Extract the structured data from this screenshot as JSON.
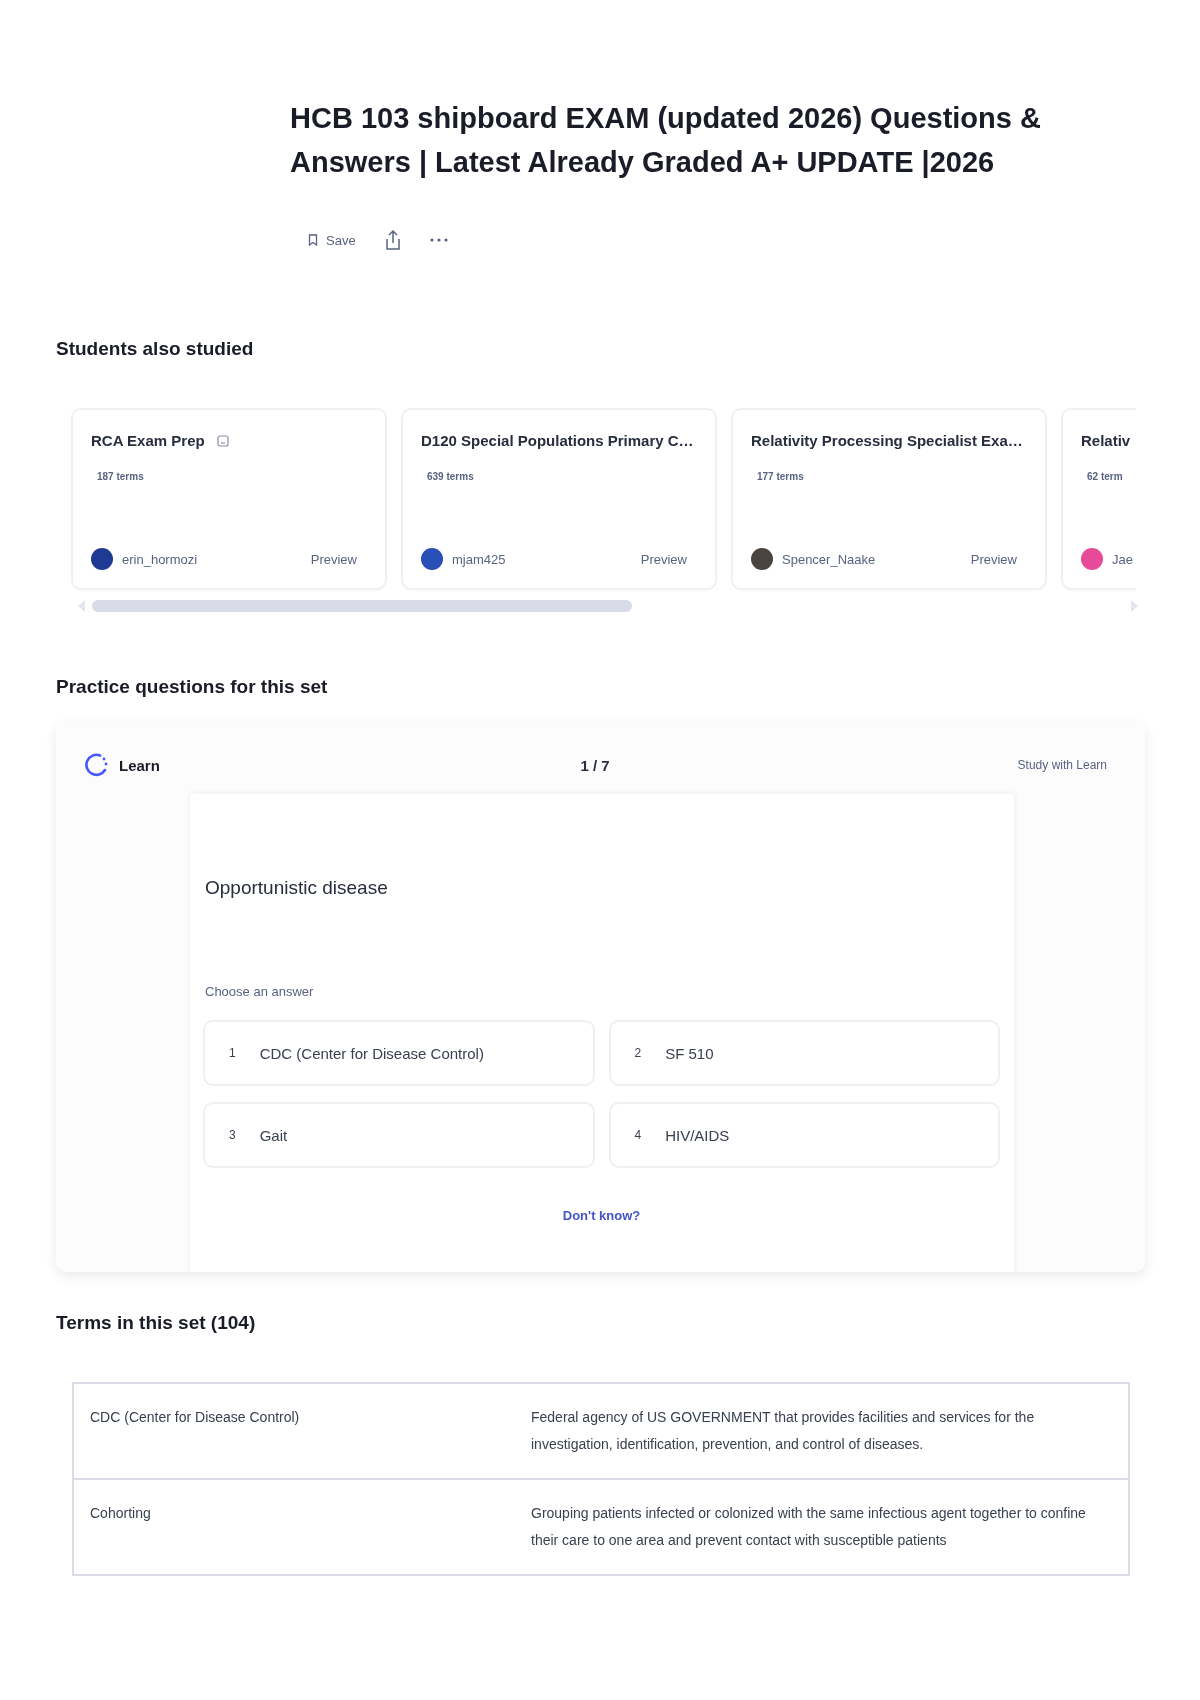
{
  "title": "HCB 103 shipboard EXAM (updated 2026) Questions & Answers | Latest Already Graded A+ UPDATE |2026",
  "actions": {
    "save": "Save"
  },
  "students_also_studied": {
    "heading": "Students also studied",
    "cards": [
      {
        "title": "RCA Exam Prep",
        "has_icon": true,
        "terms": "187 terms",
        "user": "erin_hormozi",
        "color": "#1f3a93",
        "preview": "Preview"
      },
      {
        "title": "D120 Special Populations Primary C…",
        "has_icon": false,
        "terms": "639 terms",
        "user": "mjam425",
        "color": "#2b4fb8",
        "preview": "Preview"
      },
      {
        "title": "Relativity Processing Specialist Exa…",
        "has_icon": false,
        "terms": "177 terms",
        "user": "Spencer_Naake",
        "color": "#4a4440",
        "preview": "Preview"
      },
      {
        "title": "Relativ",
        "has_icon": false,
        "terms": "62 term",
        "user": "Jae",
        "color": "#e84a9a"
      }
    ]
  },
  "practice": {
    "heading": "Practice questions for this set",
    "mode": "Learn",
    "progress": "1 / 7",
    "study_link": "Study with Learn",
    "question": "Opportunistic disease",
    "prompt": "Choose an answer",
    "options": [
      {
        "number": "1",
        "text": "CDC (Center for Disease Control)"
      },
      {
        "number": "2",
        "text": "SF 510"
      },
      {
        "number": "3",
        "text": "Gait"
      },
      {
        "number": "4",
        "text": "HIV/AIDS"
      }
    ],
    "dont_know": "Don't know?"
  },
  "terms": {
    "heading": "Terms in this set (104)",
    "rows": [
      {
        "term": "CDC (Center for Disease Control)",
        "definition": "Federal agency of US GOVERNMENT that provides facilities and services for the investigation, identification, prevention, and control of diseases."
      },
      {
        "term": "Cohorting",
        "definition": "Grouping patients infected or colonized with the same infectious agent together to confine their care to one area and prevent contact with susceptible patients"
      }
    ]
  }
}
